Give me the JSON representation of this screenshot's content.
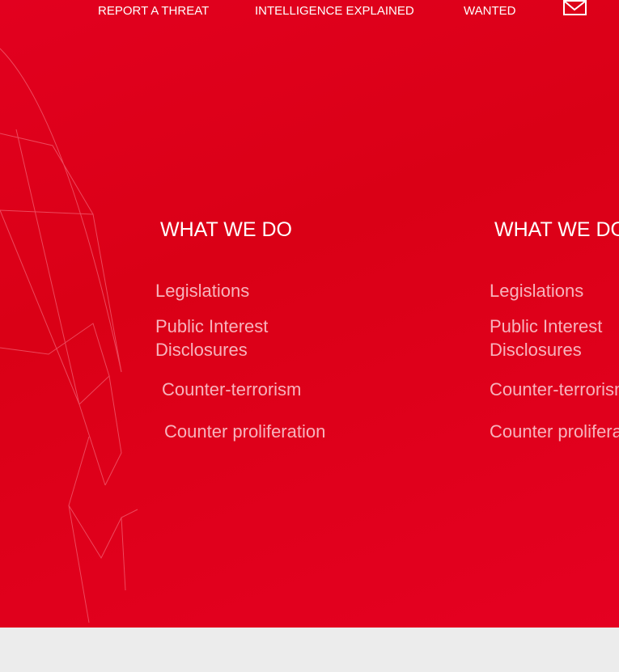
{
  "nav": {
    "items": [
      "REPORT A THREAT",
      "INTELLIGENCE EXPLAINED",
      "WANTED"
    ],
    "mail_icon": "envelope-icon"
  },
  "sections": [
    {
      "title": "WHAT WE DO",
      "links": [
        "Legislations",
        "Public Interest",
        "Disclosures",
        "Counter-terrorism",
        "Counter proliferation"
      ]
    },
    {
      "title": "WHAT WE DO",
      "links": [
        "Legislations",
        "Public Interest",
        "Disclosures",
        "Counter-terrorism",
        "Counter proliferation"
      ]
    }
  ],
  "colors": {
    "brand": "#e2001f",
    "footer": "#ececec"
  }
}
